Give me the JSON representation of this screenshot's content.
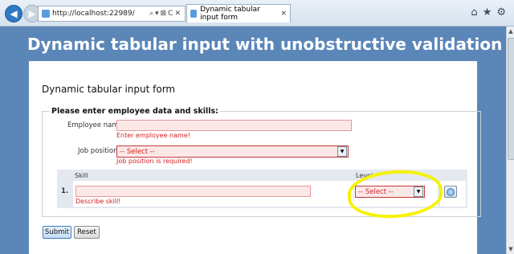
{
  "browser": {
    "url": "http://localhost:22989/",
    "address_controls": "⌕▾⊠C✕",
    "tab_title": "Dynamic tabular input form",
    "tab_close": "×",
    "icons": [
      "back-icon",
      "forward-icon",
      "home-icon",
      "favorites-icon",
      "tools-icon"
    ]
  },
  "page": {
    "title": "Dynamic tabular input with unobstructive validation",
    "form_title": "Dynamic tabular input form",
    "legend": "Please enter employee data and skills:",
    "employee_name": {
      "label": "Employee name",
      "value": "",
      "error": "Enter employee name!"
    },
    "job_position": {
      "label": "Job position",
      "selected": "-- Select --",
      "error": "Job position is required!"
    },
    "skills_table": {
      "headers": [
        "Skill",
        "Level"
      ],
      "rows": [
        {
          "number": "1.",
          "skill_value": "",
          "skill_error": "Describe skill!",
          "level_selected": "-- Select --"
        }
      ]
    },
    "submit_label": "Submit",
    "reset_label": "Reset"
  },
  "colors": {
    "page_background": "#5b86b8",
    "error_text": "#d41f1f",
    "invalid_field_background": "#fde8e8",
    "highlight": "#f6f200"
  }
}
